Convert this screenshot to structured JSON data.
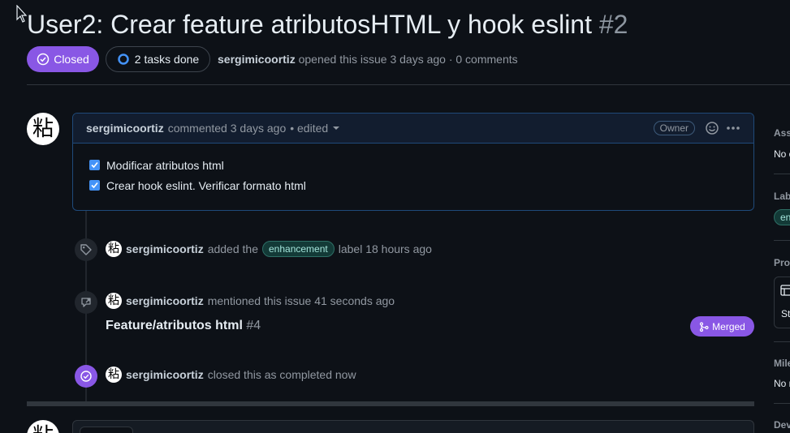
{
  "issue": {
    "title": "User2: Crear feature atributosHTML y hook eslint",
    "number": "#2",
    "state_label": "Closed",
    "tasks_label": "2 tasks done",
    "author": "sergimicoortiz",
    "opened_text": "opened this issue 3 days ago · 0 comments"
  },
  "comment": {
    "author": "sergimicoortiz",
    "meta": "commented 3 days ago",
    "edited": "• edited",
    "role": "Owner",
    "tasks": [
      {
        "label": "Modificar atributos html",
        "checked": true
      },
      {
        "label": "Crear hook eslint. Verificar formato html",
        "checked": true
      }
    ]
  },
  "timeline": {
    "label_event": {
      "author": "sergimicoortiz",
      "pre": "added the",
      "label": "enhancement",
      "post": "label 18 hours ago"
    },
    "mention_event": {
      "author": "sergimicoortiz",
      "text": "mentioned this issue 41 seconds ago",
      "pr_title": "Feature/atributos html",
      "pr_number": "#4",
      "pr_state": "Merged"
    },
    "close_event": {
      "author": "sergimicoortiz",
      "text": "closed this as completed now"
    }
  },
  "avatar_glyph": "粘",
  "sidebar": {
    "assignees_h": "Ass",
    "assignees_v": "No o",
    "labels_h": "Lab",
    "labels_v": "en",
    "projects_h": "Pro",
    "projects_v": "St",
    "milestone_h": "Mile",
    "milestone_v": "No m",
    "development_h": "Dev"
  },
  "colors": {
    "closed": "#8957e5",
    "background": "#0d1117",
    "label_enhancement": "#a4e5db"
  }
}
